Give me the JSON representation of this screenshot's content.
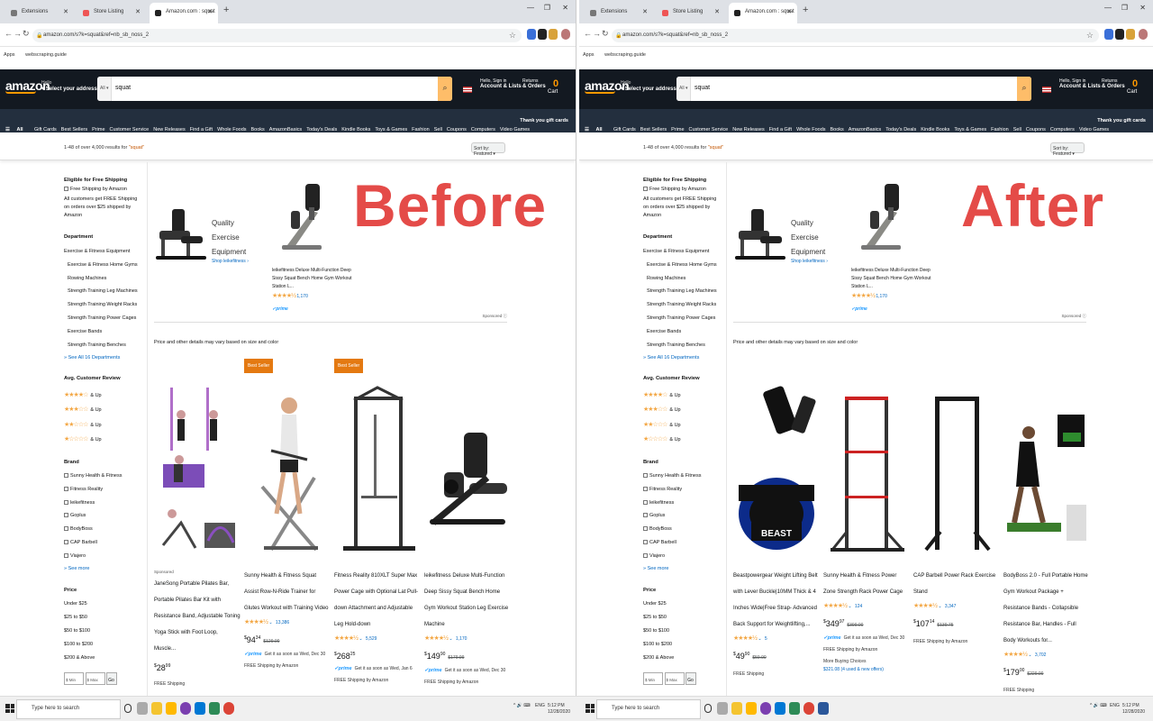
{
  "browser": {
    "tabs": [
      "Extensions",
      "Store Listing",
      "Amazon.com : squat"
    ],
    "url": "amazon.com/s?k=squat&ref=nb_sb_noss_2",
    "bookmarks": [
      "Apps",
      "webscraping.guide"
    ]
  },
  "amazon": {
    "logo": "amazon",
    "deliver_hello": "Hello",
    "deliver_label": "Select your address",
    "search_category": "All",
    "search_query": "squat",
    "account_top": "Hello, Sign in",
    "account_bottom": "Account & Lists",
    "returns_top": "Returns",
    "returns_bottom": "& Orders",
    "cart_count": "0",
    "cart_label": "Cart",
    "nav_all": "All",
    "nav_links": [
      "Gift Cards",
      "Best Sellers",
      "Prime",
      "Customer Service",
      "New Releases",
      "Find a Gift",
      "Whole Foods",
      "Books",
      "AmazonBasics",
      "Today's Deals",
      "Kindle Books",
      "Toys & Games",
      "Fashion",
      "Sell",
      "Coupons",
      "Computers",
      "Video Games"
    ],
    "nav_promo": "Thank you gift cards",
    "results_text": "1-48 of over 4,000 results for ",
    "results_query": "\"squat\"",
    "sort_label": "Sort by: Featured",
    "sidebar": {
      "free_shipping_heading": "Eligible for Free Shipping",
      "free_shipping_option": "Free Shipping by Amazon",
      "free_shipping_note": "All customers get FREE Shipping on orders over $25 shipped by Amazon",
      "department_heading": "Department",
      "department_top": "Exercise & Fitness Equipment",
      "departments": [
        "Exercise & Fitness Home Gyms",
        "Rowing Machines",
        "Strength Training Leg Machines",
        "Strength Training Weight Racks",
        "Strength Training Power Cages",
        "Exercise Bands",
        "Strength Training Benches"
      ],
      "see_all": "See All 16 Departments",
      "review_heading": "Avg. Customer Review",
      "review_rows": [
        4,
        3,
        2,
        1
      ],
      "and_up": "& Up",
      "brand_heading": "Brand",
      "brands": [
        "Sunny Health & Fitness",
        "Fitness Reality",
        "leikefitness",
        "Goplus",
        "BodyBoss",
        "CAP Barbell",
        "Viajero"
      ],
      "see_more": "See more",
      "price_heading": "Price",
      "prices": [
        "Under $25",
        "$25 to $50",
        "$50 to $100",
        "$100 to $200",
        "$200 & Above"
      ],
      "min_placeholder": "$ Min",
      "max_placeholder": "$ Max",
      "go": "Go"
    },
    "banner": {
      "title": "Quality Exercise Equipment",
      "shop_link": "Shop leikefitness ›",
      "product_title": "leikefitness Deluxe Multi-Function Deep Sissy Squat Bench Home Gym Workout Station L...",
      "rating_count": "1,170",
      "stars": 4.5,
      "prime": "prime",
      "sponsored": "Sponsored"
    },
    "price_note": "Price and other details may vary based on size and color"
  },
  "before": {
    "label": "Before",
    "products": [
      {
        "badge": "",
        "sponsored": "Sponsored",
        "title": "JaneSong Portable Pilates Bar, Portable Pilates Bar Kit with Resistance Band, Adjustable Toning Yoga Stick with Foot Loop, Muscle...",
        "rating": "",
        "stars": 0,
        "price_whole": "28",
        "price_frac": "99",
        "list_price": "",
        "prime": "",
        "delivery": "",
        "shipping": "FREE Shipping"
      },
      {
        "badge": "Best Seller",
        "sponsored": "",
        "title": "Sunny Health & Fitness Squat Assist Row-N-Ride Trainer for Glutes Workout with Training Video",
        "rating": "13,386",
        "stars": 4.5,
        "price_whole": "94",
        "price_frac": "34",
        "list_price": "$129.00",
        "prime": "prime",
        "delivery": "Get it as soon as Wed, Dec 30",
        "shipping": "FREE Shipping by Amazon"
      },
      {
        "badge": "Best Seller",
        "sponsored": "",
        "title": "Fitness Reality 810XLT Super Max Power Cage with Optional Lat Pull-down Attachment and Adjustable Leg Hold-down",
        "rating": "5,529",
        "stars": 4.5,
        "price_whole": "268",
        "price_frac": "25",
        "list_price": "",
        "prime": "prime",
        "delivery": "Get it as soon as Wed, Jan 6",
        "shipping": "FREE Shipping by Amazon"
      },
      {
        "badge": "",
        "sponsored": "",
        "title": "leikefitness Deluxe Multi-Function Deep Sissy Squat Bench Home Gym Workout Station Leg Exercise Machine",
        "rating": "1,170",
        "stars": 4.5,
        "price_whole": "149",
        "price_frac": "90",
        "list_price": "$179.99",
        "prime": "prime",
        "delivery": "Get it as soon as Wed, Dec 30",
        "shipping": "FREE Shipping by Amazon"
      }
    ]
  },
  "after": {
    "label": "After",
    "products": [
      {
        "badge": "",
        "sponsored": "",
        "title": "Beastpowergear Weight Lifting Belt with Lever Buckle|10MM Thick & 4 Inches Wide|Free Strap- Advanced Back Support for Weightlifting,...",
        "rating": "5",
        "stars": 4.5,
        "price_whole": "49",
        "price_frac": "90",
        "list_price": "$59.90",
        "prime": "",
        "delivery": "",
        "shipping": "FREE Shipping"
      },
      {
        "badge": "",
        "sponsored": "",
        "title": "Sunny Health & Fitness Power Zone Strength Rack Power Cage",
        "rating": "124",
        "stars": 4.5,
        "price_whole": "349",
        "price_frac": "97",
        "list_price": "$399.00",
        "prime": "prime",
        "delivery": "Get it as soon as Wed, Dec 30",
        "shipping": "FREE Shipping by Amazon",
        "more": "More Buying Choices",
        "more_detail": "$321.08 (4 used & new offers)"
      },
      {
        "badge": "",
        "sponsored": "",
        "title": "CAP Barbell Power Rack Exercise Stand",
        "rating": "3,347",
        "stars": 4.5,
        "price_whole": "107",
        "price_frac": "14",
        "list_price": "$139.75",
        "prime": "",
        "delivery": "",
        "shipping": "FREE Shipping by Amazon"
      },
      {
        "badge": "",
        "sponsored": "",
        "title": "BodyBoss 2.0 - Full Portable Home Gym Workout Package + Resistance Bands - Collapsible Resistance Bar, Handles - Full Body Workouts for...",
        "rating": "3,702",
        "stars": 4.5,
        "price_whole": "179",
        "price_frac": "00",
        "list_price": "$229.00",
        "prime": "",
        "delivery": "",
        "shipping": "FREE Shipping"
      }
    ]
  },
  "taskbar": {
    "search_placeholder": "Type here to search",
    "lang": "ENG",
    "time": "5:12 PM",
    "date": "12/28/2020"
  },
  "colors": {
    "accent": "#e44b48",
    "nav_dark": "#131921",
    "nav_sub": "#232f3e",
    "search_btn": "#febd69",
    "badge": "#e47911"
  }
}
